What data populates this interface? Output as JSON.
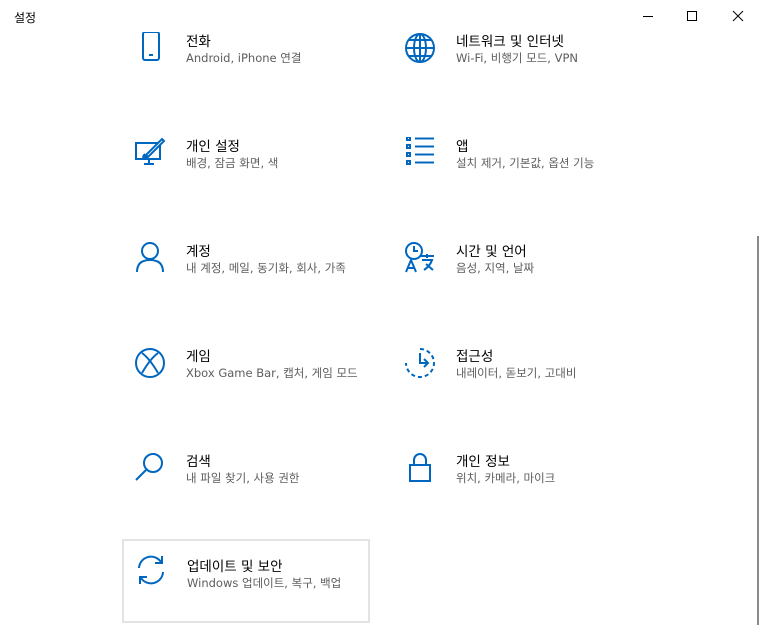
{
  "window": {
    "title": "설정"
  },
  "colors": {
    "accent": "#0067c0",
    "description": "#5d5d5d"
  },
  "tiles": [
    {
      "title": "전화",
      "desc": "Android, iPhone 연결",
      "icon": "phone-icon"
    },
    {
      "title": "네트워크 및 인터넷",
      "desc": "Wi-Fi, 비행기 모드, VPN",
      "icon": "globe-icon"
    },
    {
      "title": "개인 설정",
      "desc": "배경, 잠금 화면, 색",
      "icon": "personalization-icon"
    },
    {
      "title": "앱",
      "desc": "설치 제거, 기본값, 옵션 기능",
      "icon": "apps-list-icon"
    },
    {
      "title": "계정",
      "desc": "내 계정, 메일, 동기화, 회사, 가족",
      "icon": "person-icon"
    },
    {
      "title": "시간 및 언어",
      "desc": "음성, 지역, 날짜",
      "icon": "time-language-icon"
    },
    {
      "title": "게임",
      "desc": "Xbox Game Bar, 캡처, 게임 모드",
      "icon": "xbox-icon"
    },
    {
      "title": "접근성",
      "desc": "내레이터, 돋보기, 고대비",
      "icon": "ease-of-access-icon"
    },
    {
      "title": "검색",
      "desc": "내 파일 찾기, 사용 권한",
      "icon": "search-icon"
    },
    {
      "title": "개인 정보",
      "desc": "위치, 카메라, 마이크",
      "icon": "lock-icon"
    },
    {
      "title": "업데이트 및 보안",
      "desc": "Windows 업데이트, 복구, 백업",
      "icon": "sync-icon"
    }
  ]
}
